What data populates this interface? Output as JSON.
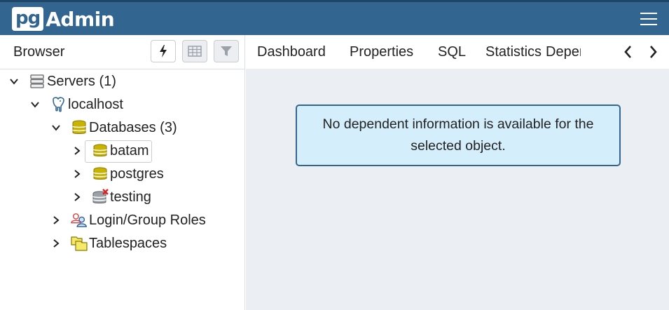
{
  "app": {
    "logo_pg": "pg",
    "logo_admin": "Admin"
  },
  "browser": {
    "title": "Browser",
    "toolbar": [
      {
        "name": "query-tool-button",
        "icon": "lightning-icon",
        "enabled": true
      },
      {
        "name": "view-data-button",
        "icon": "table-icon",
        "enabled": false
      },
      {
        "name": "filter-rows-button",
        "icon": "filter-icon",
        "enabled": false
      }
    ]
  },
  "tree": {
    "servers": "Servers (1)",
    "localhost": "localhost",
    "databases": "Databases (3)",
    "db_batam": "batam",
    "db_postgres": "postgres",
    "db_testing": "testing",
    "login_roles": "Login/Group Roles",
    "tablespaces": "Tablespaces"
  },
  "tabs": {
    "dashboard": "Dashboard",
    "properties": "Properties",
    "sql": "SQL",
    "statistics": "Statistics",
    "dependencies": "Dependencies"
  },
  "message": "No dependent information is available for the selected object.",
  "colors": {
    "header": "#326690",
    "info_bg": "#d4eefc",
    "info_border": "#326690",
    "content_bg": "#ebeef3",
    "db_icon": "#c9b200"
  }
}
